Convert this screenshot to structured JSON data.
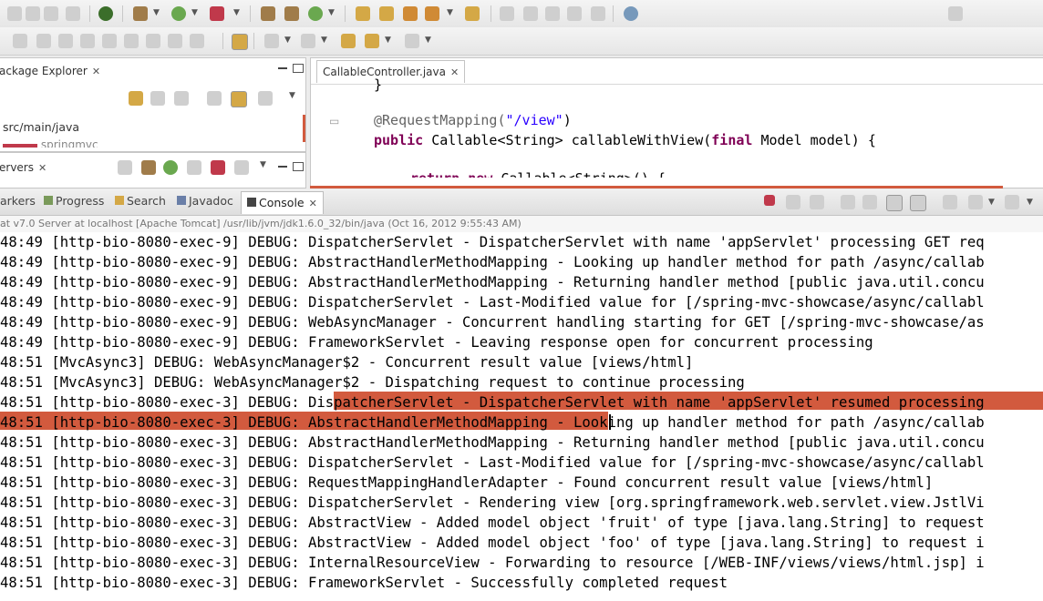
{
  "toolbar": {
    "icons_row1": [
      "new-file-icon",
      "save-icon",
      "save-all-icon",
      "print-icon",
      "perspective-icon",
      "debug-icon",
      "run-icon",
      "external-tools-icon",
      "new-server-icon",
      "new-package-icon",
      "new-class-icon",
      "open-type-icon",
      "search-icon",
      "open-task-icon",
      "annotation-icon",
      "web-browser-icon"
    ],
    "icons_row2": [
      "skip-breakpoints-icon",
      "stop-icon",
      "disconnect-icon",
      "step-into-icon",
      "step-over-icon",
      "step-return-icon",
      "drop-to-frame-icon",
      "use-step-filters-icon",
      "next-annotation-icon",
      "prev-annotation-icon",
      "last-edit-icon",
      "back-icon",
      "forward-icon"
    ]
  },
  "package_explorer": {
    "tab_label": "ackage Explorer",
    "tree_item": "src/main/java",
    "tree_item_2": "springmvc"
  },
  "servers": {
    "tab_label": "ervers"
  },
  "editor": {
    "tab_label": "CallableController.java",
    "lines": {
      "l0": "}",
      "l1_annotation": "@RequestMapping(",
      "l1_string": "\"/view\"",
      "l1_close": ")",
      "l2_kw1": "public",
      "l2_mid": " Callable<String> callableWithView(",
      "l2_kw2": "final",
      "l2_end": " Model model) {",
      "l3_kw": "return",
      "l3_kw2": " new",
      "l3_end": " Callable<String>() {"
    }
  },
  "console_tabs": {
    "markers": "arkers",
    "progress": "Progress",
    "search": "Search",
    "javadoc": "Javadoc",
    "console": "Console"
  },
  "console_description": "at v7.0 Server at localhost [Apache Tomcat] /usr/lib/jvm/jdk1.6.0_32/bin/java (Oct 16, 2012 9:55:43 AM)",
  "console_lines": [
    "48:49 [http-bio-8080-exec-9] DEBUG: DispatcherServlet - DispatcherServlet with name 'appServlet' processing GET req",
    "48:49 [http-bio-8080-exec-9] DEBUG: AbstractHandlerMethodMapping - Looking up handler method for path /async/callab",
    "48:49 [http-bio-8080-exec-9] DEBUG: AbstractHandlerMethodMapping - Returning handler method [public java.util.concu",
    "48:49 [http-bio-8080-exec-9] DEBUG: DispatcherServlet - Last-Modified value for [/spring-mvc-showcase/async/callabl",
    "48:49 [http-bio-8080-exec-9] DEBUG: WebAsyncManager - Concurrent handling starting for GET [/spring-mvc-showcase/as",
    "48:49 [http-bio-8080-exec-9] DEBUG: FrameworkServlet - Leaving response open for concurrent processing",
    "48:51 [MvcAsync3] DEBUG: WebAsyncManager$2 - Concurrent result value [views/html]",
    "48:51 [MvcAsync3] DEBUG: WebAsyncManager$2 - Dispatching request to continue processing",
    "48:51 [http-bio-8080-exec-3] DEBUG: DispatcherServlet - DispatcherServlet with name 'appServlet' resumed processing",
    "48:51 [http-bio-8080-exec-3] DEBUG: AbstractHandlerMethodMapping - Looking up handler method for path /async/callab",
    "48:51 [http-bio-8080-exec-3] DEBUG: AbstractHandlerMethodMapping - Returning handler method [public java.util.concu",
    "48:51 [http-bio-8080-exec-3] DEBUG: DispatcherServlet - Last-Modified value for [/spring-mvc-showcase/async/callabl",
    "48:51 [http-bio-8080-exec-3] DEBUG: RequestMappingHandlerAdapter - Found concurrent result value [views/html]",
    "48:51 [http-bio-8080-exec-3] DEBUG: DispatcherServlet - Rendering view [org.springframework.web.servlet.view.JstlVi",
    "48:51 [http-bio-8080-exec-3] DEBUG: AbstractView - Added model object 'fruit' of type [java.lang.String] to request",
    "48:51 [http-bio-8080-exec-3] DEBUG: AbstractView - Added model object 'foo' of type [java.lang.String] to request i",
    "48:51 [http-bio-8080-exec-3] DEBUG: InternalResourceView - Forwarding to resource [/WEB-INF/views/views/html.jsp] i",
    "48:51 [http-bio-8080-exec-3] DEBUG: FrameworkServlet - Successfully completed request"
  ],
  "colors": {
    "selection": "#d25a3e",
    "keyword": "#7f0055",
    "string": "#2a00ff"
  }
}
